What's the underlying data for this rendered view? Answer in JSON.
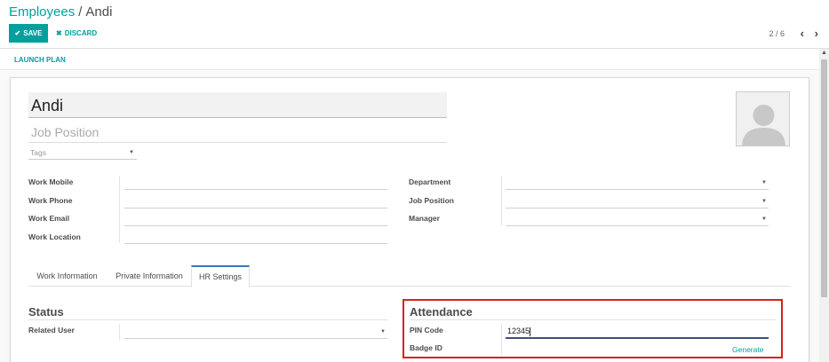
{
  "breadcrumb": {
    "parent": "Employees",
    "separator": "/",
    "current": "Andi"
  },
  "toolbar": {
    "save_label": "SAVE",
    "discard_label": "DISCARD"
  },
  "pager": {
    "value": "2 / 6",
    "prev_icon": "chevron-left-icon",
    "next_icon": "chevron-right-icon"
  },
  "statusbar": {
    "launch_plan_label": "LAUNCH PLAN"
  },
  "employee": {
    "name": "Andi",
    "job_position_placeholder": "Job Position",
    "tags_placeholder": "Tags"
  },
  "left_fields": [
    {
      "label": "Work Mobile",
      "value": ""
    },
    {
      "label": "Work Phone",
      "value": ""
    },
    {
      "label": "Work Email",
      "value": ""
    },
    {
      "label": "Work Location",
      "value": ""
    }
  ],
  "right_fields": [
    {
      "label": "Department",
      "value": ""
    },
    {
      "label": "Job Position",
      "value": ""
    },
    {
      "label": "Manager",
      "value": ""
    }
  ],
  "tabs": [
    {
      "label": "Work Information",
      "active": false
    },
    {
      "label": "Private Information",
      "active": false
    },
    {
      "label": "HR Settings",
      "active": true
    }
  ],
  "status_section": {
    "title": "Status",
    "related_user_label": "Related User",
    "related_user_value": ""
  },
  "attendance_section": {
    "title": "Attendance",
    "pin_code_label": "PIN Code",
    "pin_code_value": "12345",
    "badge_id_label": "Badge ID",
    "badge_id_value": "",
    "generate_label": "Generate"
  },
  "colors": {
    "accent": "#00a09d",
    "tab_active_border": "#3f76b5",
    "highlight": "#d9211e"
  }
}
